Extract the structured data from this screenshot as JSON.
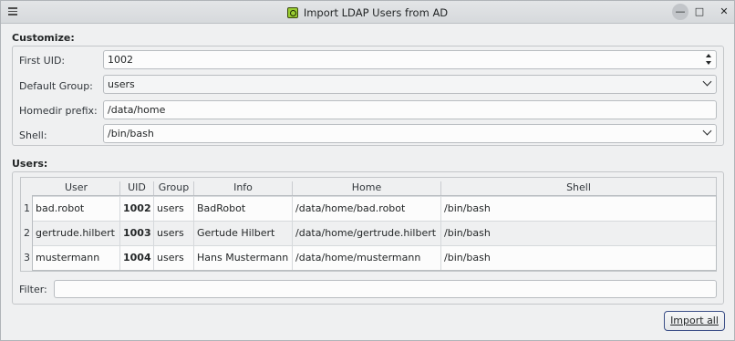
{
  "window": {
    "title": "Import LDAP Users from AD",
    "icons": [
      "menu-icon",
      "app-icon",
      "minimize-icon",
      "maximize-icon",
      "close-icon"
    ]
  },
  "customize": {
    "heading": "Customize:",
    "first_uid_label": "First UID:",
    "first_uid_value": "1002",
    "default_group_label": "Default Group:",
    "default_group_value": "users",
    "homedir_prefix_label": "Homedir prefix:",
    "homedir_prefix_value": "/data/home",
    "shell_label": "Shell:",
    "shell_value": "/bin/bash"
  },
  "users": {
    "heading": "Users:",
    "columns": [
      "User",
      "UID",
      "Group",
      "Info",
      "Home",
      "Shell"
    ],
    "rows": [
      {
        "num": "1",
        "user": "bad.robot",
        "uid": "1002",
        "group": "users",
        "info": "BadRobot",
        "home": "/data/home/bad.robot",
        "shell": "/bin/bash"
      },
      {
        "num": "2",
        "user": "gertrude.hilbert",
        "uid": "1003",
        "group": "users",
        "info": "Gertude Hilbert",
        "home": "/data/home/gertrude.hilbert",
        "shell": "/bin/bash"
      },
      {
        "num": "3",
        "user": "mustermann",
        "uid": "1004",
        "group": "users",
        "info": "Hans Mustermann",
        "home": "/data/home/mustermann",
        "shell": "/bin/bash"
      }
    ]
  },
  "filter": {
    "label": "Filter:",
    "value": ""
  },
  "buttons": {
    "import_all": "Import all"
  }
}
